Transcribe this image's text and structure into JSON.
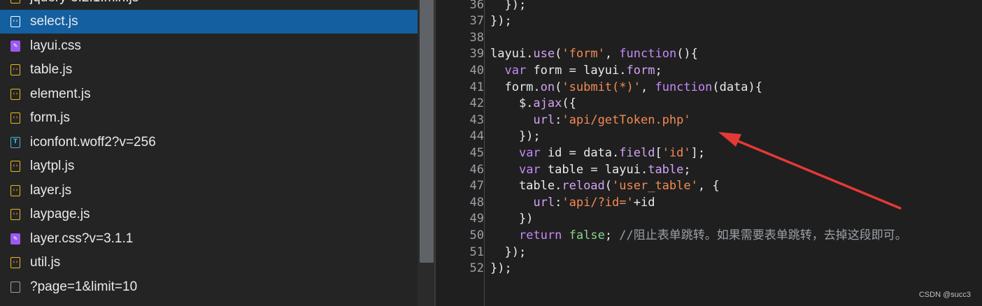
{
  "file_list": [
    {
      "name": "jquery-3.2.1.min.js",
      "type": "js",
      "selected": false
    },
    {
      "name": "select.js",
      "type": "js",
      "selected": true
    },
    {
      "name": "layui.css",
      "type": "css",
      "selected": false
    },
    {
      "name": "table.js",
      "type": "js",
      "selected": false
    },
    {
      "name": "element.js",
      "type": "js",
      "selected": false
    },
    {
      "name": "form.js",
      "type": "js",
      "selected": false
    },
    {
      "name": "iconfont.woff2?v=256",
      "type": "font",
      "selected": false
    },
    {
      "name": "laytpl.js",
      "type": "js",
      "selected": false
    },
    {
      "name": "layer.js",
      "type": "js",
      "selected": false
    },
    {
      "name": "laypage.js",
      "type": "js",
      "selected": false
    },
    {
      "name": "layer.css?v=3.1.1",
      "type": "css",
      "selected": false
    },
    {
      "name": "util.js",
      "type": "js",
      "selected": false
    },
    {
      "name": "?page=1&limit=10",
      "type": "doc",
      "selected": false
    }
  ],
  "icon_names": {
    "js": "js-file-icon",
    "css": "css-file-icon",
    "font": "font-file-icon",
    "doc": "document-file-icon"
  },
  "icon_glyphs": {
    "js": "‹›",
    "css": "✎",
    "font": "T",
    "doc": ""
  },
  "editor": {
    "lines": [
      {
        "n": "36",
        "tokens": [
          [
            "plain",
            "  });"
          ]
        ]
      },
      {
        "n": "37",
        "tokens": [
          [
            "plain",
            "});"
          ]
        ]
      },
      {
        "n": "38",
        "tokens": []
      },
      {
        "n": "39",
        "tokens": [
          [
            "plain",
            "layui."
          ],
          [
            "fn",
            "use"
          ],
          [
            "plain",
            "("
          ],
          [
            "str",
            "'form'"
          ],
          [
            "plain",
            ", "
          ],
          [
            "kw",
            "function"
          ],
          [
            "plain",
            "(){"
          ]
        ]
      },
      {
        "n": "40",
        "tokens": [
          [
            "plain",
            "  "
          ],
          [
            "kw",
            "var"
          ],
          [
            "plain",
            " form = layui."
          ],
          [
            "fn",
            "form"
          ],
          [
            "plain",
            ";"
          ]
        ]
      },
      {
        "n": "41",
        "tokens": [
          [
            "plain",
            "  form."
          ],
          [
            "fn",
            "on"
          ],
          [
            "plain",
            "("
          ],
          [
            "str",
            "'submit(*)'"
          ],
          [
            "plain",
            ", "
          ],
          [
            "kw",
            "function"
          ],
          [
            "plain",
            "(data){"
          ]
        ]
      },
      {
        "n": "42",
        "tokens": [
          [
            "plain",
            "    $."
          ],
          [
            "fn",
            "ajax"
          ],
          [
            "plain",
            "({"
          ]
        ]
      },
      {
        "n": "43",
        "tokens": [
          [
            "plain",
            "      "
          ],
          [
            "fn",
            "url"
          ],
          [
            "plain",
            ":"
          ],
          [
            "str",
            "'api/getToken.php'"
          ]
        ]
      },
      {
        "n": "44",
        "tokens": [
          [
            "plain",
            "    });"
          ]
        ]
      },
      {
        "n": "45",
        "tokens": [
          [
            "plain",
            "    "
          ],
          [
            "kw",
            "var"
          ],
          [
            "plain",
            " id = data."
          ],
          [
            "fn",
            "field"
          ],
          [
            "plain",
            "["
          ],
          [
            "str",
            "'id'"
          ],
          [
            "plain",
            "];"
          ]
        ]
      },
      {
        "n": "46",
        "tokens": [
          [
            "plain",
            "    "
          ],
          [
            "kw",
            "var"
          ],
          [
            "plain",
            " table = layui."
          ],
          [
            "fn",
            "table"
          ],
          [
            "plain",
            ";"
          ]
        ]
      },
      {
        "n": "47",
        "tokens": [
          [
            "plain",
            "    table."
          ],
          [
            "fn",
            "reload"
          ],
          [
            "plain",
            "("
          ],
          [
            "str",
            "'user_table'"
          ],
          [
            "plain",
            ", {"
          ]
        ]
      },
      {
        "n": "48",
        "tokens": [
          [
            "plain",
            "      "
          ],
          [
            "fn",
            "url"
          ],
          [
            "plain",
            ":"
          ],
          [
            "str",
            "'api/?id='"
          ],
          [
            "plain",
            "+id"
          ]
        ]
      },
      {
        "n": "49",
        "tokens": [
          [
            "plain",
            "    })"
          ]
        ]
      },
      {
        "n": "50",
        "tokens": [
          [
            "plain",
            "    "
          ],
          [
            "kw",
            "return"
          ],
          [
            "plain",
            " "
          ],
          [
            "lit",
            "false"
          ],
          [
            "plain",
            "; "
          ],
          [
            "com",
            "//阻止表单跳转。如果需要表单跳转，去掉这段即可。"
          ]
        ]
      },
      {
        "n": "51",
        "tokens": [
          [
            "plain",
            "  });"
          ]
        ]
      },
      {
        "n": "52",
        "tokens": [
          [
            "plain",
            "});"
          ]
        ]
      }
    ]
  },
  "watermark": "CSDN @succ3",
  "colors": {
    "selected_row": "#135f9f",
    "arrow": "#e53935"
  }
}
